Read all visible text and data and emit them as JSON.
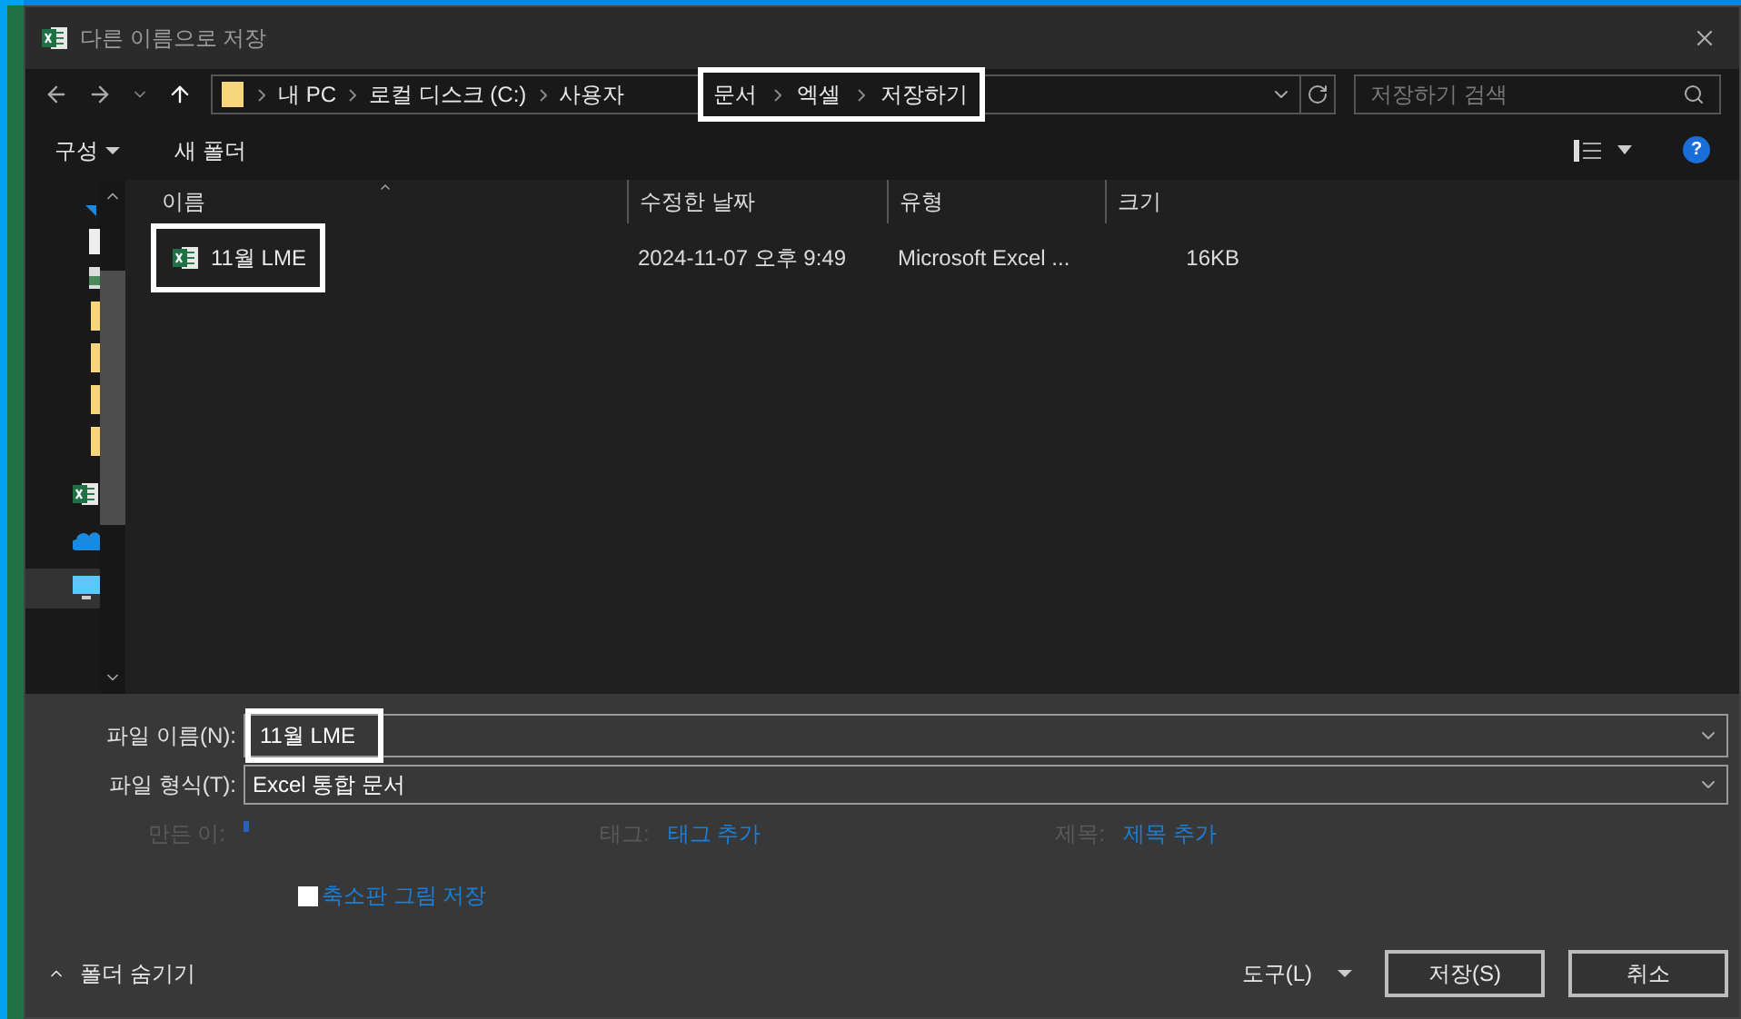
{
  "window": {
    "title": "다른 이름으로 저장"
  },
  "address_bar": {
    "path": [
      {
        "label": "내 PC",
        "highlighted": false
      },
      {
        "label": "로컬 디스크 (C:)",
        "highlighted": false
      },
      {
        "label": "사용자",
        "highlighted": false
      },
      {
        "label": "문서",
        "highlighted": true
      },
      {
        "label": "엑셀",
        "highlighted": true
      },
      {
        "label": "저장하기",
        "highlighted": true
      }
    ]
  },
  "search": {
    "placeholder": "저장하기 검색"
  },
  "toolbar": {
    "organize": "구성",
    "new_folder": "새 폴더",
    "help": "?"
  },
  "table": {
    "columns": [
      "이름",
      "수정한 날짜",
      "유형",
      "크기"
    ],
    "rows": [
      {
        "name": "11월 LME",
        "date": "2024-11-07 오후 9:49",
        "type": "Microsoft Excel ...",
        "size": "16KB",
        "highlighted": true
      }
    ]
  },
  "form": {
    "file_name": {
      "label": "파일 이름(N):",
      "value": "11월 LME",
      "highlighted": true
    },
    "file_type": {
      "label": "파일 형식(T):",
      "value": "Excel 통합 문서"
    },
    "authors": {
      "label": "만든 이:"
    },
    "tags": {
      "label": "태그:",
      "link": "태그 추가"
    },
    "title": {
      "label": "제목:",
      "link": "제목 추가"
    },
    "thumbnail": {
      "label": "축소판 그림 저장",
      "checked": false
    }
  },
  "footer": {
    "hide_folders": "폴더 숨기기",
    "tools": "도구(L)",
    "buttons": [
      "저장(S)",
      "취소"
    ]
  }
}
